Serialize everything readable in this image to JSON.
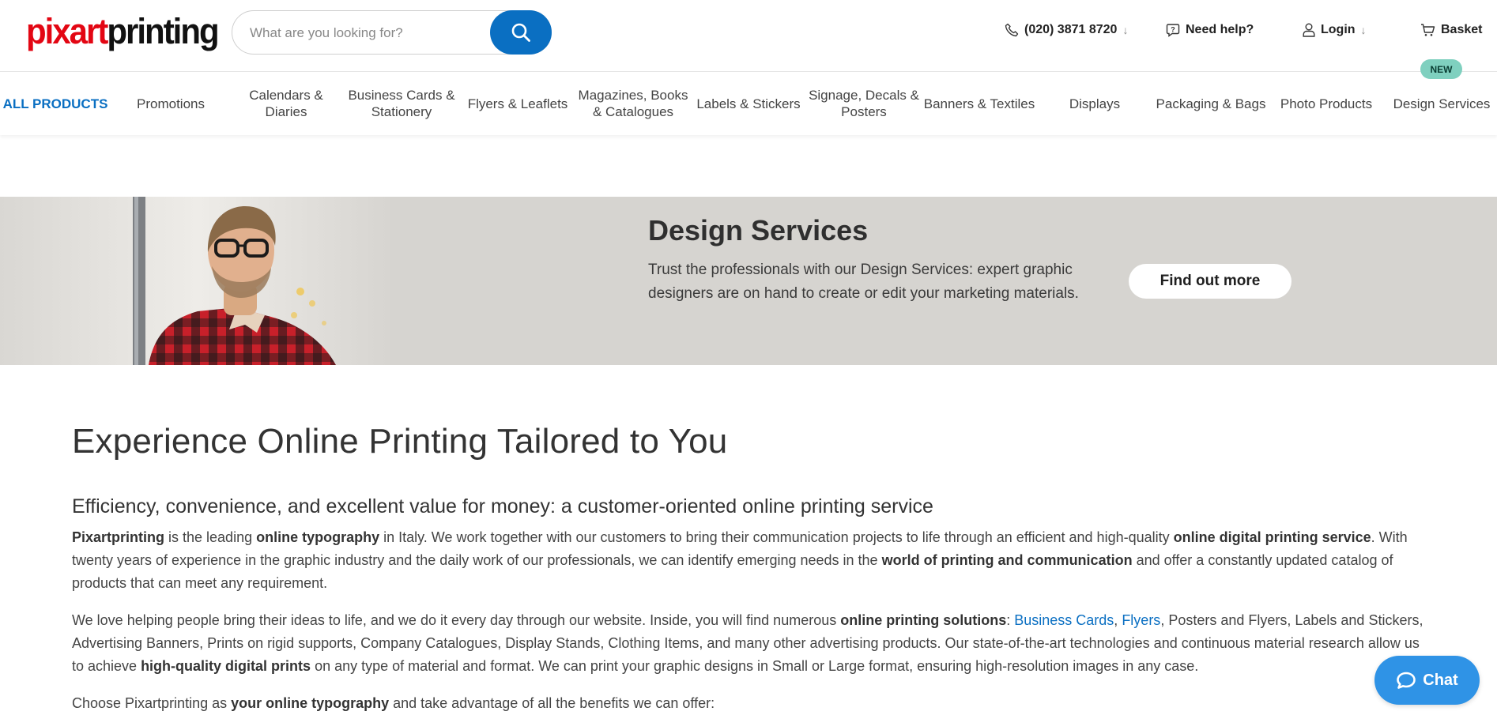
{
  "header": {
    "logo": {
      "part1": "pixart",
      "part2": "printing"
    },
    "search": {
      "placeholder": "What are you looking for?"
    },
    "phone": "(020) 3871 8720",
    "help": "Need help?",
    "login": "Login",
    "basket": "Basket"
  },
  "nav": {
    "items": [
      {
        "label": "ALL PRODUCTS"
      },
      {
        "label": "Promotions"
      },
      {
        "label": "Calendars & Diaries"
      },
      {
        "label": "Business Cards & Stationery"
      },
      {
        "label": "Flyers & Leaflets"
      },
      {
        "label": "Magazines, Books & Catalogues"
      },
      {
        "label": "Labels & Stickers"
      },
      {
        "label": "Signage, Decals & Posters"
      },
      {
        "label": "Banners & Textiles"
      },
      {
        "label": "Displays"
      },
      {
        "label": "Packaging & Bags"
      },
      {
        "label": "Photo Products"
      },
      {
        "label": "Design Services"
      }
    ],
    "new_badge": "NEW"
  },
  "banner": {
    "title": "Design Services",
    "text": "Trust the professionals with our Design Services: expert graphic designers are on hand to create or edit your marketing materials.",
    "button": "Find out more"
  },
  "content": {
    "heading": "Experience Online Printing Tailored to You",
    "subheading": "Efficiency, convenience, and excellent value for money: a customer-oriented online printing service",
    "p1": {
      "b1": "Pixartprinting",
      "t1": " is the leading ",
      "b2": "online typography",
      "t2": " in Italy. We work together with our customers to bring their communication projects to life through an efficient and high-quality ",
      "b3": "online digital printing service",
      "t3": ". With twenty years of experience in the graphic industry and the daily work of our professionals, we can identify emerging needs in the ",
      "b4": "world of printing and communication",
      "t4": " and offer a constantly updated catalog of products that can meet any requirement."
    },
    "p2": {
      "t1": "We love helping people bring their ideas to life, and we do it every day through our website. Inside, you will find numerous ",
      "b1": "online printing solutions",
      "t2": ": ",
      "link1": "Business Cards",
      "t3": ", ",
      "link2": "Flyers",
      "t4": ", Posters and Flyers, Labels and Stickers, Advertising Banners, Prints on rigid supports, Company Catalogues, Display Stands, Clothing Items, and many other advertising products. Our state-of-the-art technologies and continuous material research allow us to achieve ",
      "b2": "high-quality digital prints",
      "t5": " on any type of material and format. We can print your graphic designs in Small or Large format, ensuring high-resolution images in any case."
    },
    "p3": {
      "t1": "Choose Pixartprinting as ",
      "b1": "your online typography",
      "t2": " and take advantage of all the benefits we can offer:"
    }
  },
  "chat": {
    "label": "Chat"
  },
  "colors": {
    "accent": "#0a6fc2",
    "logo_red": "#e30613",
    "banner_bg": "#d6d4d0",
    "badge": "#7fd0bf",
    "chat": "#2f93e6"
  }
}
